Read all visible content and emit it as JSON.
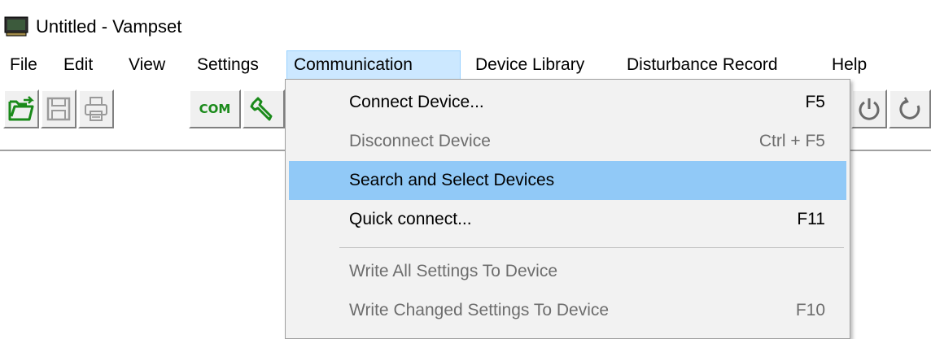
{
  "window": {
    "title": "Untitled - Vampset",
    "app_icon": "monitor-icon"
  },
  "menubar": {
    "items": [
      {
        "label": "File"
      },
      {
        "label": "Edit"
      },
      {
        "label": "View"
      },
      {
        "label": "Settings"
      },
      {
        "label": "Communication",
        "active": true
      },
      {
        "label": "Device Library"
      },
      {
        "label": "Disturbance Record"
      },
      {
        "label": "Help"
      }
    ]
  },
  "toolbar": {
    "buttons": [
      {
        "name": "open",
        "icon": "open-folder-icon"
      },
      {
        "name": "save",
        "icon": "save-disk-icon"
      },
      {
        "name": "print",
        "icon": "printer-icon"
      },
      {
        "name": "com",
        "label": "COM"
      },
      {
        "name": "settings",
        "icon": "wrench-icon"
      },
      {
        "name": "power",
        "icon": "power-icon"
      },
      {
        "name": "restart",
        "icon": "restart-icon"
      }
    ]
  },
  "communication_menu": {
    "items": [
      {
        "label": "Connect Device...",
        "shortcut": "F5",
        "enabled": true
      },
      {
        "label": "Disconnect Device",
        "shortcut": "Ctrl + F5",
        "enabled": false
      },
      {
        "label": "Search and Select Devices",
        "shortcut": "",
        "enabled": true,
        "highlighted": true
      },
      {
        "label": "Quick connect...",
        "shortcut": "F11",
        "enabled": true
      },
      {
        "label": "Write All Settings To Device",
        "shortcut": "",
        "enabled": false
      },
      {
        "label": "Write Changed Settings To Device",
        "shortcut": "F10",
        "enabled": false
      }
    ]
  },
  "colors": {
    "menu_highlight": "#91c9f7",
    "menubar_active": "#cce8ff",
    "disabled_text": "#6d6d6d",
    "icon_green": "#1a8a1a"
  }
}
